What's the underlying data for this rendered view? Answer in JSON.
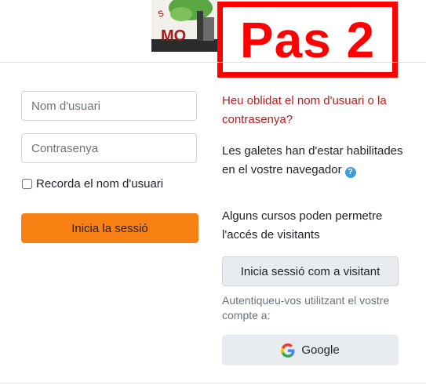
{
  "logo_text": "MO",
  "annotation": {
    "label": "Pas 2",
    "color": "#ff0000"
  },
  "login_form": {
    "username_placeholder": "Nom d'usuari",
    "password_placeholder": "Contrasenya",
    "remember_label": "Recorda el nom d'usuari",
    "remember_checked": false,
    "login_button": "Inicia la sessió",
    "button_color": "#f98012"
  },
  "side": {
    "forgot_link": "Heu oblidat el nom d'usuari o la contrasenya?",
    "cookies_text": "Les galetes han d'estar habilitades en el vostre navegador",
    "help_icon": "question-circle-icon",
    "guest_text": "Alguns cursos poden permetre l'accés de visitants",
    "guest_button": "Inicia sessió com a visitant",
    "auth_text": "Autentiqueu-vos utilitzant el vostre compte a:",
    "google_button": "Google"
  }
}
